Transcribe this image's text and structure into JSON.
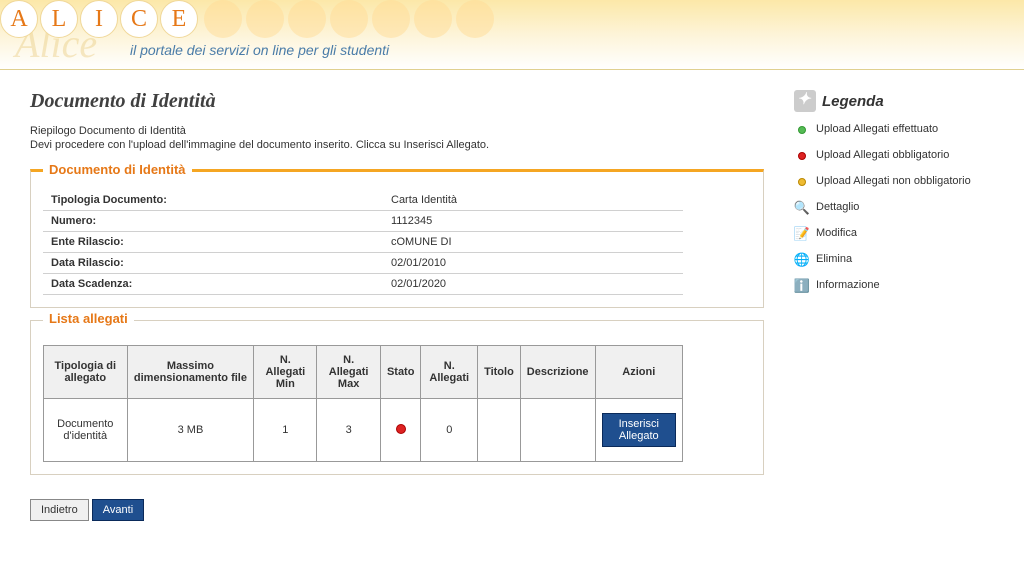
{
  "header": {
    "logo_letters": [
      "A",
      "L",
      "I",
      "C",
      "E"
    ],
    "tagline": "il portale dei servizi on line per gli studenti"
  },
  "page": {
    "title": "Documento di Identità",
    "subtitle": "Riepilogo Documento di Identità",
    "description": "Devi procedere con l'upload dell'immagine del documento inserito. Clicca su Inserisci Allegato."
  },
  "doc_section": {
    "legend": "Documento di Identità",
    "rows": [
      {
        "label": "Tipologia Documento:",
        "value": "Carta Identità"
      },
      {
        "label": "Numero:",
        "value": "1112345"
      },
      {
        "label": "Ente Rilascio:",
        "value": "cOMUNE DI"
      },
      {
        "label": "Data Rilascio:",
        "value": "02/01/2010"
      },
      {
        "label": "Data Scadenza:",
        "value": "02/01/2020"
      }
    ]
  },
  "list_section": {
    "legend": "Lista allegati",
    "headers": {
      "tipologia": "Tipologia di allegato",
      "max_size": "Massimo dimensionamento file",
      "n_min": "N. Allegati Min",
      "n_max": "N. Allegati Max",
      "stato": "Stato",
      "n_allegati": "N. Allegati",
      "titolo": "Titolo",
      "descrizione": "Descrizione",
      "azioni": "Azioni"
    },
    "rows": [
      {
        "tipologia": "Documento d'identità",
        "max_size": "3 MB",
        "n_min": "1",
        "n_max": "3",
        "stato": "red",
        "n_allegati": "0",
        "titolo": "",
        "descrizione": "",
        "action_label": "Inserisci Allegato"
      }
    ]
  },
  "buttons": {
    "back": "Indietro",
    "next": "Avanti"
  },
  "legend": {
    "title": "Legenda",
    "items": [
      {
        "icon": "green",
        "text": "Upload Allegati effettuato"
      },
      {
        "icon": "red",
        "text": "Upload Allegati obbligatorio"
      },
      {
        "icon": "yellow",
        "text": "Upload Allegati non obbligatorio"
      },
      {
        "icon": "magnify",
        "text": "Dettaglio"
      },
      {
        "icon": "edit",
        "text": "Modifica"
      },
      {
        "icon": "delete",
        "text": "Elimina"
      },
      {
        "icon": "info",
        "text": "Informazione"
      }
    ]
  }
}
